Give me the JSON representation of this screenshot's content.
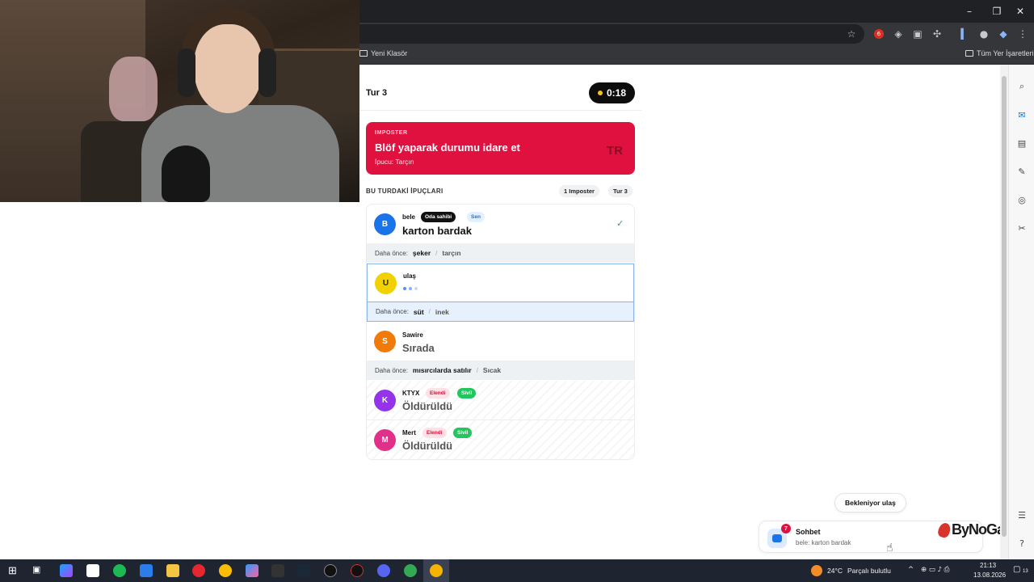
{
  "window": {
    "min_icon": "minimize-icon",
    "max_icon": "restore-icon",
    "close_icon": "close-icon"
  },
  "bookmarks": {
    "left": "Yeni Klasör",
    "right": "Tüm Yer İşaretleri"
  },
  "extension_badge": "6",
  "game": {
    "round_title": "Tur 3",
    "timer": "0:18",
    "role": {
      "kicker": "IMPOSTER",
      "title": "Blöf yaparak durumu idare et",
      "hint": "İpucu: Tarçın",
      "lang": "TR",
      "color": "#e0103f"
    },
    "clues_heading": "BU TURDAKİ İPUÇLARI",
    "pill_imposter": "1 Imposter",
    "pill_round": "Tur 3",
    "previous_label": "Daha önce:",
    "players": [
      {
        "initial": "B",
        "name": "bele",
        "tag1": "Oda sahibi",
        "tag2": "Sen",
        "clue": "karton bardak",
        "color": "#1a73e8",
        "prev": [
          "şeker",
          "tarçın"
        ]
      },
      {
        "initial": "U",
        "name": "ulaş",
        "clue": "",
        "color": "#f2d100",
        "prev": [
          "süt",
          "inek"
        ]
      },
      {
        "initial": "S",
        "name": "Sawire",
        "clue": "Sırada",
        "color": "#f07a0a",
        "prev": [
          "mısırcılarda satılır",
          "Sıcak"
        ]
      },
      {
        "initial": "K",
        "name": "KTYX",
        "tag1": "Elendi",
        "tag2": "Sivil",
        "clue": "Öldürüldü",
        "color": "#9333ea"
      },
      {
        "initial": "M",
        "name": "Mert",
        "tag1": "Elendi",
        "tag2": "Sivil",
        "clue": "Öldürüldü",
        "color": "#e0308a"
      }
    ],
    "waiting": "Bekleniyor ulaş",
    "chat": {
      "title": "Sohbet",
      "preview": "bele: karton bardak",
      "badge": "7"
    },
    "logo": "ByNoGame"
  },
  "taskbar": {
    "weather": "24°C",
    "weather_text": "Parçalı bulutlu",
    "time": "21:13",
    "date": "13.08.2026",
    "notif_count": "13"
  }
}
